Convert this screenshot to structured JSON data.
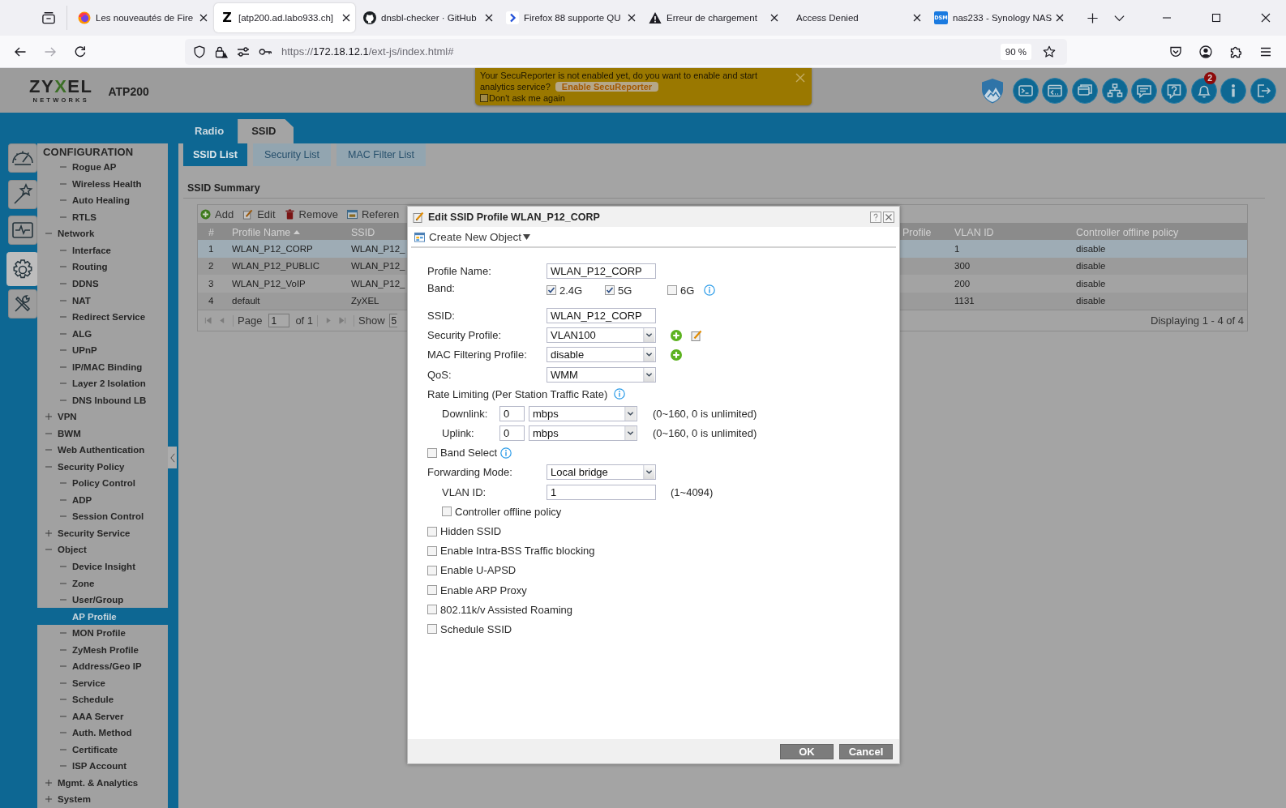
{
  "browser": {
    "tabs": [
      {
        "title": "Les nouveautés de Fire",
        "selected": false
      },
      {
        "favicon_text": "Z",
        "title": "[atp200.ad.labo933.ch]",
        "selected": true
      },
      {
        "title": "dnsbl-checker · GitHub",
        "selected": false
      },
      {
        "title": "Firefox 88 supporte QU",
        "selected": false
      },
      {
        "title": "Erreur de chargement",
        "selected": false
      },
      {
        "title": "Access Denied",
        "selected": false
      },
      {
        "favicon_text": "DSM",
        "title": "nas233 - Synology NAS",
        "selected": false
      }
    ],
    "can_go_forward": false,
    "url": {
      "scheme": "https://",
      "host": "172.18.12.1",
      "path": "/ext-js/index.html#"
    },
    "zoom": "90 %"
  },
  "app": {
    "logo": "ZYXEL",
    "logo_tagline": "NETWORKS",
    "model": "ATP200",
    "alert_count": "2",
    "banner": {
      "message_lines": [
        "Your SecuReporter is not enabled yet, do you want to enable and start",
        "analytics service?"
      ],
      "button": "Enable SecuReporter",
      "checkbox": {
        "label": "Don't ask me again",
        "checked": false
      }
    }
  },
  "sidebar": {
    "rail": [
      {
        "selected": false
      },
      {
        "selected": false
      },
      {
        "selected": false
      },
      {
        "selected": true
      },
      {
        "selected": false
      }
    ],
    "title": "CONFIGURATION",
    "tree": [
      {
        "children": [
          {
            "label": "Rogue AP",
            "selected": false
          },
          {
            "label": "Wireless Health",
            "selected": false
          },
          {
            "label": "Auto Healing",
            "selected": false
          },
          {
            "label": "RTLS",
            "selected": false
          }
        ]
      },
      {
        "label": "Network",
        "expanded": true,
        "selected": false,
        "children": [
          {
            "label": "Interface",
            "selected": false
          },
          {
            "label": "Routing",
            "selected": false
          },
          {
            "label": "DDNS",
            "selected": false
          },
          {
            "label": "NAT",
            "selected": false
          },
          {
            "label": "Redirect Service",
            "selected": false
          },
          {
            "label": "ALG",
            "selected": false
          },
          {
            "label": "UPnP",
            "selected": false
          },
          {
            "label": "IP/MAC Binding",
            "selected": false
          },
          {
            "label": "Layer 2 Isolation",
            "selected": false
          },
          {
            "label": "DNS Inbound LB",
            "selected": false
          }
        ]
      },
      {
        "label": "VPN",
        "expanded": false,
        "selected": false
      },
      {
        "label": "BWM",
        "selected": false
      },
      {
        "label": "Web Authentication",
        "selected": false
      },
      {
        "label": "Security Policy",
        "expanded": true,
        "selected": false,
        "children": [
          {
            "label": "Policy Control",
            "selected": false
          },
          {
            "label": "ADP",
            "selected": false
          },
          {
            "label": "Session Control",
            "selected": false
          }
        ]
      },
      {
        "label": "Security Service",
        "expanded": false,
        "selected": false
      },
      {
        "label": "Object",
        "expanded": true,
        "selected": false,
        "children": [
          {
            "label": "Device Insight",
            "selected": false
          },
          {
            "label": "Zone",
            "selected": false
          },
          {
            "label": "User/Group",
            "selected": false
          },
          {
            "label": "AP Profile",
            "selected": true
          },
          {
            "label": "MON Profile",
            "selected": false
          },
          {
            "label": "ZyMesh Profile",
            "selected": false
          },
          {
            "label": "Address/Geo IP",
            "selected": false
          },
          {
            "label": "Service",
            "selected": false
          },
          {
            "label": "Schedule",
            "selected": false
          },
          {
            "label": "AAA Server",
            "selected": false
          },
          {
            "label": "Auth. Method",
            "selected": false
          },
          {
            "label": "Certificate",
            "selected": false
          },
          {
            "label": "ISP Account",
            "selected": false
          }
        ]
      },
      {
        "label": "Mgmt. & Analytics",
        "expanded": false,
        "selected": false
      },
      {
        "label": "System",
        "expanded": false,
        "selected": false
      }
    ]
  },
  "main_tabs": [
    {
      "label": "Radio",
      "selected": false
    },
    {
      "label": "SSID",
      "selected": true
    }
  ],
  "sub_tabs": [
    {
      "label": "SSID List",
      "selected": true
    },
    {
      "label": "Security List",
      "selected": false
    },
    {
      "label": "MAC Filter List",
      "selected": false
    }
  ],
  "summary": {
    "title": "SSID Summary",
    "toolbar": [
      {
        "label": "Add"
      },
      {
        "label": "Edit"
      },
      {
        "label": "Remove"
      },
      {
        "label": "Referen"
      }
    ],
    "columns": [
      {
        "label": "#",
        "sorted": false
      },
      {
        "label": "Profile Name",
        "sorted": true
      },
      {
        "label": "SSID",
        "sorted": false
      },
      {
        "label": "Profile",
        "sorted": false
      },
      {
        "label": "VLAN ID",
        "sorted": false
      },
      {
        "label": "Controller offline policy",
        "sorted": false
      }
    ],
    "rows": [
      {
        "cells": [
          "1",
          "WLAN_P12_CORP",
          "WLAN_P12_",
          null,
          "1",
          "disable"
        ],
        "selected": true
      },
      {
        "cells": [
          "2",
          "WLAN_P12_PUBLIC",
          "WLAN_P12_",
          null,
          "300",
          "disable"
        ],
        "selected": false
      },
      {
        "cells": [
          "3",
          "WLAN_P12_VoIP",
          "WLAN_P12_",
          null,
          "200",
          "disable"
        ],
        "selected": false
      },
      {
        "cells": [
          "4",
          "default",
          "ZyXEL",
          null,
          "1131",
          "disable"
        ],
        "selected": false
      }
    ],
    "paging": {
      "page_label": "Page",
      "page": "1",
      "page_count": "of 1",
      "show_label": "Show",
      "page_size": "5",
      "status": "Displaying 1 - 4 of 4"
    }
  },
  "dialog": {
    "title": "Edit SSID Profile WLAN_P12_CORP",
    "create_button": "Create New Object",
    "fields": [
      {
        "kind": "text",
        "label": "Profile Name:",
        "value": "WLAN_P12_CORP"
      },
      {
        "kind": "checks",
        "label": "Band:",
        "info": true,
        "options": [
          {
            "label": "2.4G",
            "checked": true
          },
          {
            "label": "5G",
            "checked": true
          },
          {
            "label": "6G",
            "checked": false
          }
        ]
      },
      {
        "kind": "text",
        "label": "SSID:",
        "value": "WLAN_P12_CORP"
      },
      {
        "kind": "select",
        "label": "Security Profile:",
        "value": "VLAN100",
        "add": true,
        "edit": true
      },
      {
        "kind": "select",
        "label": "MAC Filtering Profile:",
        "value": "disable",
        "add": true
      },
      {
        "kind": "select",
        "label": "QoS:",
        "value": "WMM"
      },
      {
        "kind": "heading",
        "label": "Rate Limiting (Per Station Traffic Rate)",
        "info": true,
        "children": [
          {
            "kind": "rate",
            "label": "Downlink:",
            "value": "0",
            "unit": "mbps",
            "hint": "(0~160, 0 is unlimited)"
          },
          {
            "kind": "rate",
            "label": "Uplink:",
            "value": "0",
            "unit": "mbps",
            "hint": "(0~160, 0 is unlimited)"
          }
        ]
      },
      {
        "kind": "checkbox",
        "label": "Band Select",
        "checked": false,
        "info": true
      },
      {
        "kind": "select",
        "label": "Forwarding Mode:",
        "value": "Local bridge",
        "children": [
          {
            "kind": "text",
            "label": "VLAN ID:",
            "value": "1",
            "hint": "(1~4094)"
          },
          {
            "kind": "checkbox",
            "label": "Controller offline policy",
            "checked": false
          }
        ]
      },
      {
        "kind": "checkbox",
        "label": "Hidden SSID",
        "checked": false
      },
      {
        "kind": "checkbox",
        "label": "Enable Intra-BSS Traffic blocking",
        "checked": false
      },
      {
        "kind": "checkbox",
        "label": "Enable U-APSD",
        "checked": false
      },
      {
        "kind": "checkbox",
        "label": "Enable ARP Proxy",
        "checked": false
      },
      {
        "kind": "checkbox",
        "label": "802.11k/v Assisted Roaming",
        "checked": false
      },
      {
        "kind": "checkbox",
        "label": "Schedule SSID",
        "checked": false
      }
    ],
    "buttons": [
      {
        "label": "OK"
      },
      {
        "label": "Cancel"
      }
    ]
  }
}
